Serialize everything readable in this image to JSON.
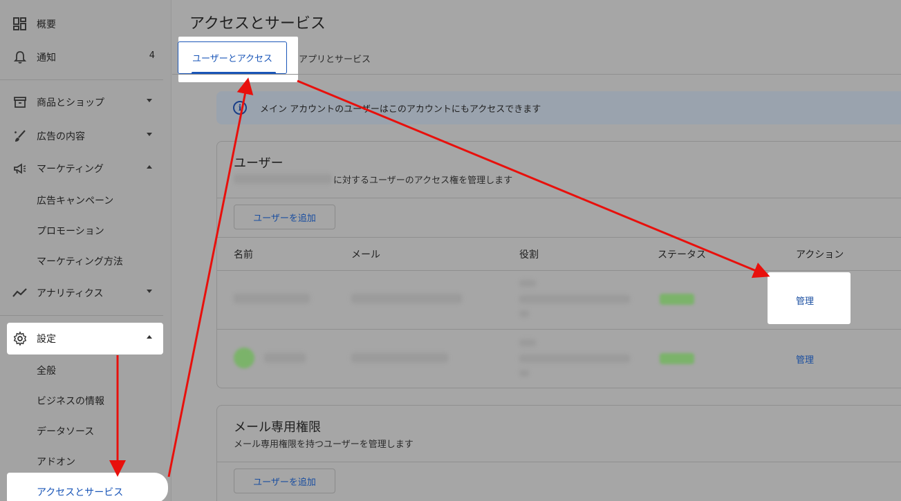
{
  "sidebar": {
    "items": [
      {
        "label": "概要",
        "icon": "dashboard-icon"
      },
      {
        "label": "通知",
        "icon": "bell-icon",
        "count": "4"
      },
      {
        "label": "商品とショップ",
        "icon": "store-icon"
      },
      {
        "label": "広告の内容",
        "icon": "brush-icon"
      },
      {
        "label": "マーケティング",
        "icon": "megaphone-icon"
      },
      {
        "label": "アナリティクス",
        "icon": "trend-icon"
      },
      {
        "label": "設定",
        "icon": "gear-icon"
      }
    ],
    "marketing_sub": [
      "広告キャンペーン",
      "プロモーション",
      "マーケティング方法"
    ],
    "settings_sub": [
      "全般",
      "ビジネスの情報",
      "データソース",
      "アドオン",
      "アクセスとサービス"
    ]
  },
  "main": {
    "title": "アクセスとサービス",
    "tabs": [
      {
        "label": "ユーザーとアクセス"
      },
      {
        "label": "アプリとサービス"
      }
    ],
    "info_banner": "メイン アカウントのユーザーはこのアカウントにもアクセスできます",
    "users_card": {
      "title": "ユーザー",
      "subtitle": "に対するユーザーのアクセス権を管理します",
      "add_button": "ユーザーを追加",
      "columns": [
        "名前",
        "メール",
        "役割",
        "ステータス",
        "アクション"
      ],
      "rows": [
        {
          "action": "管理"
        },
        {
          "action": "管理"
        }
      ]
    },
    "email_card": {
      "title": "メール専用権限",
      "subtitle": "メール専用権限を持つユーザーを管理します",
      "add_button": "ユーザーを追加"
    }
  },
  "colors": {
    "accent": "#1a56b8",
    "annotation_arrow": "#e8100c"
  }
}
